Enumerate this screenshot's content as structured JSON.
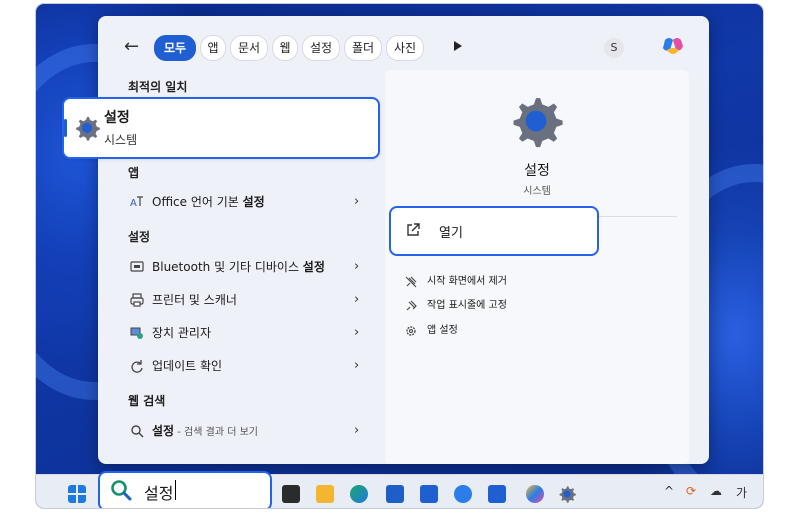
{
  "filters": [
    {
      "label": "모두",
      "active": true
    },
    {
      "label": "앱",
      "active": false
    },
    {
      "label": "문서",
      "active": false
    },
    {
      "label": "웹",
      "active": false
    },
    {
      "label": "설정",
      "active": false
    },
    {
      "label": "폴더",
      "active": false
    },
    {
      "label": "사진",
      "active": false
    }
  ],
  "avatar_letter": "S",
  "sections": {
    "best_match": "최적의 일치",
    "apps": "앱",
    "settings": "설정",
    "web": "웹 검색"
  },
  "best_match": {
    "title": "설정",
    "subtitle": "시스템"
  },
  "app_results": [
    {
      "prefix": "Office 언어 기본 ",
      "bold": "설정"
    }
  ],
  "settings_results": [
    {
      "prefix": "Bluetooth 및 기타 디바이스 ",
      "bold": "설정"
    },
    {
      "prefix": "프린터 및 스캐너",
      "bold": ""
    },
    {
      "prefix": "장치 관리자",
      "bold": ""
    },
    {
      "prefix": "업데이트 확인",
      "bold": ""
    }
  ],
  "web_result": {
    "bold": "설정",
    "suffix": " - 검색 결과 더 보기"
  },
  "detail": {
    "title": "설정",
    "subtitle": "시스템",
    "open_label": "열기",
    "actions": [
      "시작 화면에서 제거",
      "작업 표시줄에 고정",
      "앱 설정"
    ]
  },
  "taskbar": {
    "search_text": "설정",
    "ime": "가"
  },
  "colors": {
    "accent": "#1f5fd1",
    "highlight_border": "#2563eb"
  }
}
